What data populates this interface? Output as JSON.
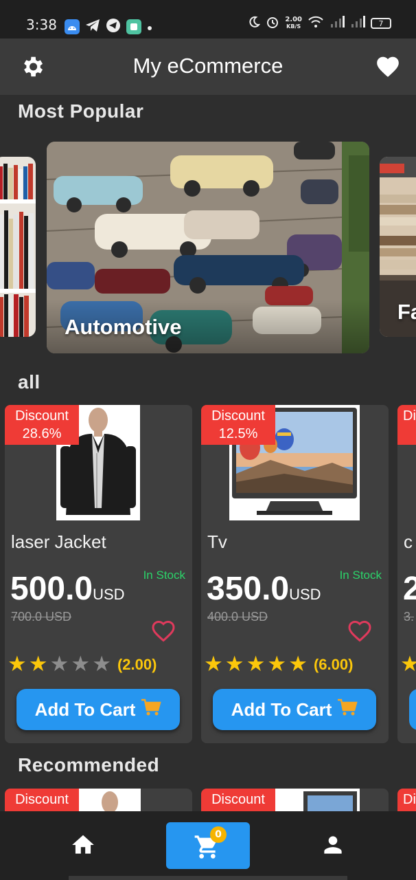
{
  "status_bar": {
    "time": "3:38",
    "net_speed": "2.00",
    "net_unit": "KB/S",
    "battery": "7"
  },
  "app_bar": {
    "title": "My eCommerce",
    "settings_icon": "gear-icon",
    "favorites_icon": "heart-icon"
  },
  "popular": {
    "title": "Most Popular",
    "categories": [
      {
        "label": ""
      },
      {
        "label": "Automotive"
      },
      {
        "label": "Fa"
      }
    ]
  },
  "all_section": {
    "title": "all",
    "products": [
      {
        "discount_label": "Discount",
        "discount_value": "28.6%",
        "name": "laser  Jacket",
        "stock": "In Stock",
        "price": "500.0",
        "currency": "USD",
        "old_price": "700.0 USD",
        "rating": 2,
        "rating_label": "(2.00)",
        "cart_label": "Add To Cart"
      },
      {
        "discount_label": "Discount",
        "discount_value": "12.5%",
        "name": "Tv",
        "stock": "In Stock",
        "price": "350.0",
        "currency": "USD",
        "old_price": "400.0 USD",
        "rating": 5,
        "rating_label": "(6.00)",
        "cart_label": "Add To Cart"
      },
      {
        "discount_label": "Di",
        "name": "c",
        "price": "2",
        "old_price": "3."
      }
    ]
  },
  "recommended": {
    "title": "Recommended",
    "cards": [
      {
        "discount_label": "Discount"
      },
      {
        "discount_label": "Discount"
      },
      {
        "discount_label": "Di"
      }
    ]
  },
  "bottom_nav": {
    "cart_count": "0"
  },
  "colors": {
    "accent": "#2696f0",
    "discount": "#ef3b36",
    "in_stock": "#2bd46a",
    "star": "#fbc70b"
  }
}
